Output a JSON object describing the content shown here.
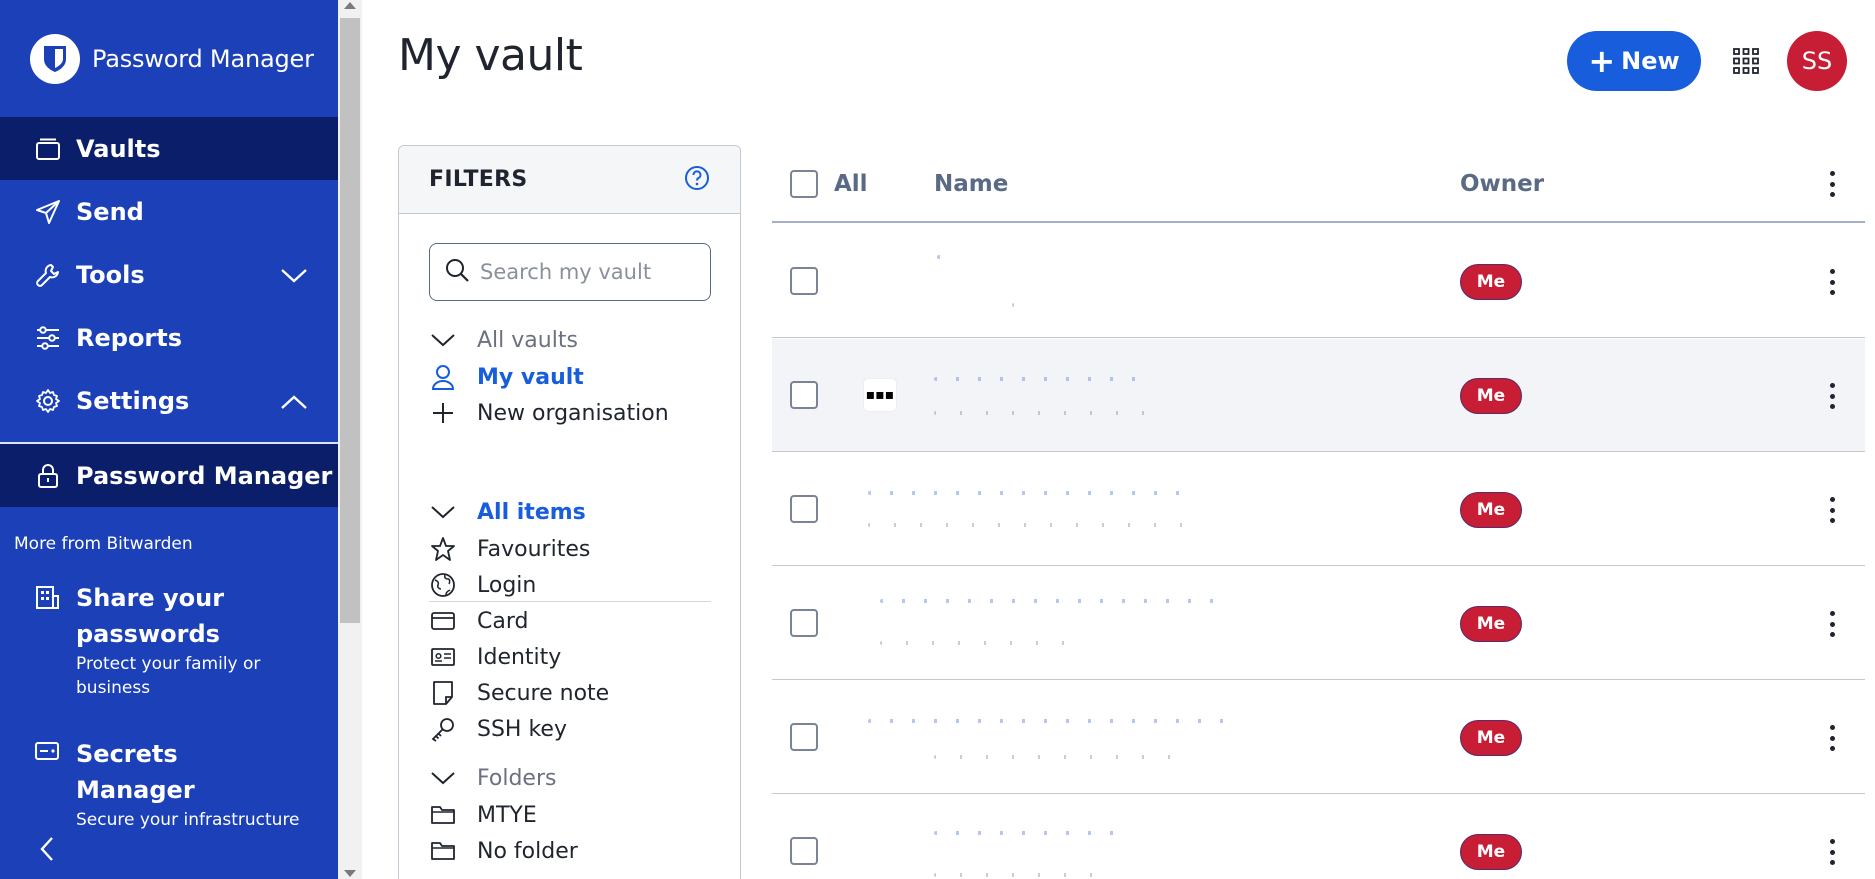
{
  "sidebar": {
    "brand": "Password Manager",
    "nav": {
      "vaults": "Vaults",
      "send": "Send",
      "tools": "Tools",
      "reports": "Reports",
      "settings": "Settings"
    },
    "product": "Password Manager",
    "more_from": "More from Bitwarden",
    "promos": [
      {
        "title": "Share your passwords",
        "desc": "Protect your family or business"
      },
      {
        "title": "Secrets Manager",
        "desc": "Secure your infrastructure"
      }
    ]
  },
  "header": {
    "title": "My vault",
    "new_label": "New",
    "avatar_initials": "SS"
  },
  "filters": {
    "title": "FILTERS",
    "search_placeholder": "Search my vault",
    "vaults": {
      "all_vaults": "All vaults",
      "my_vault": "My vault",
      "new_organisation": "New organisation"
    },
    "types": {
      "all_items": "All items",
      "favourites": "Favourites",
      "login": "Login",
      "card": "Card",
      "identity": "Identity",
      "secure_note": "Secure note",
      "ssh_key": "SSH key"
    },
    "folders": {
      "label": "Folders",
      "items": [
        "MTYE",
        "No folder"
      ]
    }
  },
  "table": {
    "columns": {
      "all": "All",
      "name": "Name",
      "owner": "Owner"
    },
    "rows": [
      {
        "owner": "Me"
      },
      {
        "owner": "Me",
        "icon": "▪▪▪"
      },
      {
        "owner": "Me"
      },
      {
        "owner": "Me"
      },
      {
        "owner": "Me"
      },
      {
        "owner": "Me"
      }
    ]
  },
  "colors": {
    "sidebar_bg": "#1b40b8",
    "sidebar_active": "#0b1e6a",
    "primary": "#175ddc",
    "badge": "#c71d35"
  },
  "icons": {
    "brand": "bitwarden-shield-icon",
    "vaults": "vault-icon",
    "send": "paper-plane-icon",
    "tools": "wrench-icon",
    "reports": "sliders-icon",
    "settings": "gear-icon",
    "product": "lock-icon",
    "share": "building-icon",
    "secrets": "server-icon",
    "collapse": "chevron-left-icon",
    "help": "help-circle-icon",
    "search": "search-icon",
    "grid": "app-grid-icon"
  }
}
